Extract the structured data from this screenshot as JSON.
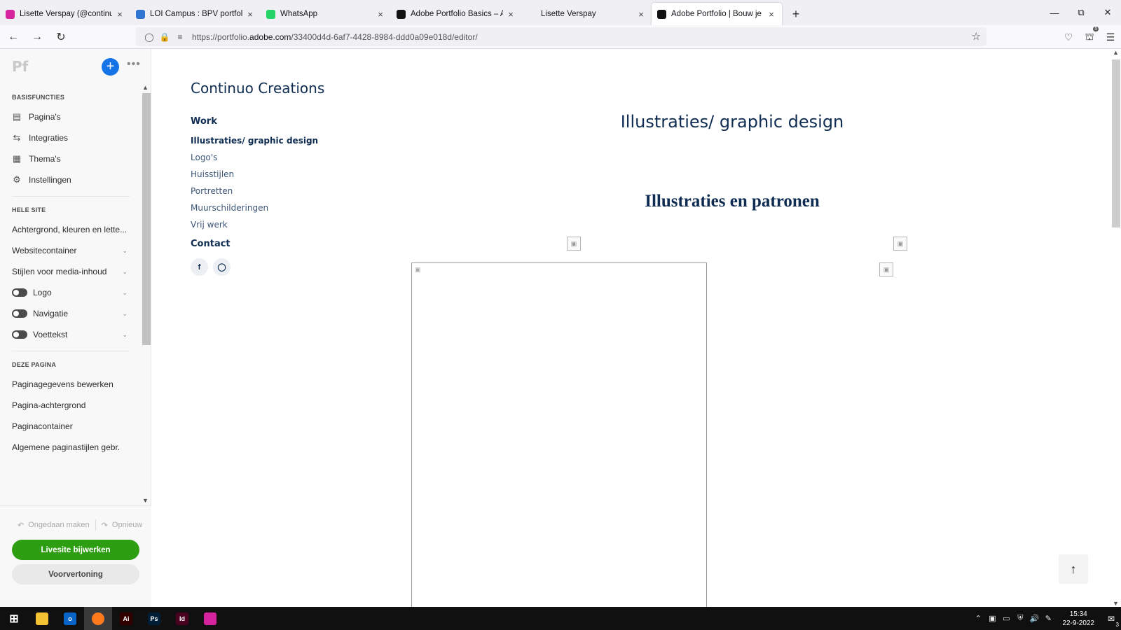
{
  "browser": {
    "tabs": [
      {
        "title": "Lisette Verspay (@continuo_cre",
        "favicon": "instagram-icon",
        "color": "#d6249f",
        "active": false
      },
      {
        "title": "LOI Campus : BPV portfolio [24",
        "favicon": "loi-icon",
        "color": "#2f76d2",
        "active": false
      },
      {
        "title": "WhatsApp",
        "favicon": "whatsapp-icon",
        "color": "#25d366",
        "active": false
      },
      {
        "title": "Adobe Portfolio Basics – Adobe",
        "favicon": "adobe-portfolio-icon",
        "color": "#111111",
        "active": false
      },
      {
        "title": "Lisette Verspay",
        "favicon": "",
        "color": "",
        "active": false
      },
      {
        "title": "Adobe Portfolio | Bouw je eigen",
        "favicon": "adobe-portfolio-icon",
        "color": "#111111",
        "active": true
      }
    ],
    "url_prefix": "https://portfolio.",
    "url_domain": "adobe.com",
    "url_suffix": "/33400d4d-6af7-4428-8984-ddd0a09e018d/editor/",
    "extension_badge": "5"
  },
  "editor": {
    "logo": "Pf",
    "sections": [
      {
        "heading": "BASISFUNCTIES",
        "items": [
          {
            "label": "Pagina's",
            "icon": "page-icon"
          },
          {
            "label": "Integraties",
            "icon": "integrations-icon"
          },
          {
            "label": "Thema's",
            "icon": "themes-icon"
          },
          {
            "label": "Instellingen",
            "icon": "gear-icon"
          }
        ]
      },
      {
        "heading": "HELE SITE",
        "items": [
          {
            "label": "Achtergrond, kleuren en lette...",
            "toggle": false,
            "chevron": false
          },
          {
            "label": "Websitecontainer",
            "toggle": false,
            "chevron": true
          },
          {
            "label": "Stijlen voor media-inhoud",
            "toggle": false,
            "chevron": true
          },
          {
            "label": "Logo",
            "toggle": true,
            "chevron": true
          },
          {
            "label": "Navigatie",
            "toggle": true,
            "chevron": true
          },
          {
            "label": "Voettekst",
            "toggle": true,
            "chevron": true
          }
        ]
      },
      {
        "heading": "DEZE PAGINA",
        "items": [
          {
            "label": "Paginagegevens bewerken"
          },
          {
            "label": "Pagina-achtergrond"
          },
          {
            "label": "Paginacontainer"
          },
          {
            "label": "Algemene paginastijlen gebr."
          }
        ]
      }
    ],
    "undo_label": "Ongedaan maken",
    "redo_label": "Opnieuw",
    "update_live_label": "Livesite bijwerken",
    "preview_label": "Voorvertoning",
    "accent_green": "#2d9d12",
    "accent_blue": "#1473e6"
  },
  "site": {
    "title": "Continuo Creations",
    "nav": {
      "work": "Work",
      "projects": [
        {
          "label": "Illustraties/ graphic design",
          "current": true
        },
        {
          "label": "Logo's",
          "current": false
        },
        {
          "label": "Huisstijlen",
          "current": false
        },
        {
          "label": "Portretten",
          "current": false
        },
        {
          "label": "Muurschilderingen",
          "current": false
        },
        {
          "label": "Vrij werk",
          "current": false
        }
      ],
      "contact": "Contact"
    },
    "social": [
      "f",
      "instagram-icon"
    ],
    "page_title": "Illustraties/ graphic design",
    "section_title": "Illustraties en patronen",
    "primary_color": "#0f2d52"
  },
  "taskbar": {
    "apps": [
      {
        "name": "windows-start-icon",
        "label": "",
        "color": "transparent"
      },
      {
        "name": "file-explorer-icon",
        "label": "",
        "color": "#f2c233"
      },
      {
        "name": "outlook-icon",
        "label": "o",
        "color": "#0a64c8"
      },
      {
        "name": "firefox-icon",
        "label": "",
        "color": "#ff7a1a"
      },
      {
        "name": "illustrator-icon",
        "label": "Ai",
        "color": "#330000"
      },
      {
        "name": "photoshop-icon",
        "label": "Ps",
        "color": "#001e36"
      },
      {
        "name": "indesign-icon",
        "label": "Id",
        "color": "#49021f"
      },
      {
        "name": "instagram-icon",
        "label": "",
        "color": "#d6249f"
      }
    ],
    "time": "15:34",
    "date": "22-9-2022",
    "notification_count": "3"
  }
}
